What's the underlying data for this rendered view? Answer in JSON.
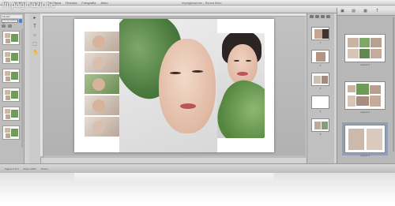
{
  "app": {
    "name": "impaginazione",
    "document_title": "Impaginazione - Senza titolo"
  },
  "menubar": {
    "items": [
      "File",
      "Modifica",
      "Inserisci",
      "Visualizza",
      "Finestra",
      "Fotografia",
      "Aiuto"
    ]
  },
  "left_panel": {
    "header": "Modelli",
    "select_value": "Composizione 2",
    "thumb_labels": [
      "1",
      "2",
      "3",
      "4",
      "5",
      "6"
    ]
  },
  "tools": [
    "arrow",
    "text",
    "zoom",
    "crop",
    "hand"
  ],
  "spread": {
    "strip_photos": 5
  },
  "page_panel": {
    "thumb_labels": [
      "1",
      "2",
      "3",
      "4",
      "5"
    ]
  },
  "right_panel": {
    "icons": [
      "page-icon",
      "layout-icon",
      "grid-icon",
      "text-icon"
    ],
    "layout_labels": [
      "Layout 1",
      "Layout 2",
      "Layout 3"
    ]
  },
  "statusbar": {
    "items": [
      "Pagina 1 di 5",
      "Zoom 100%",
      "Pronto"
    ]
  }
}
